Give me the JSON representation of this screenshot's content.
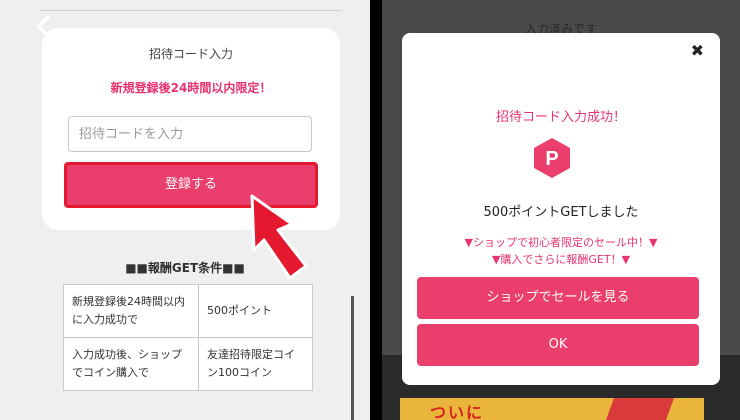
{
  "left": {
    "card": {
      "title": "招待コード入力",
      "limit_note": "新規登録後24時間以内限定！",
      "input_placeholder": "招待コードを入力",
      "register_button": "登録する"
    },
    "conditions": {
      "title": "■■報酬GET条件■■",
      "rows": [
        {
          "condition": "新規登録後24時間以内に入力成功で",
          "reward": "500ポイント"
        },
        {
          "condition": "入力成功後、ショップでコイン購入で",
          "reward": "友達招待限定コイン100コイン"
        }
      ]
    }
  },
  "right": {
    "background_text": "入力済みです",
    "banner_text": "ついに",
    "modal": {
      "title": "招待コード入力成功！",
      "icon_letter": "P",
      "points_text": "500ポイントGETしました",
      "promo_line1": "▼ショップで初心者限定のセール中！▼",
      "promo_line2": "▼購入でさらに報酬GET！▼",
      "shop_button": "ショップでセールを見る",
      "ok_button": "OK"
    }
  },
  "colors": {
    "accent": "#ea3e6c",
    "accent_text": "#e8336f",
    "highlight_border": "#e4182e",
    "arrow": "#e4182e"
  }
}
